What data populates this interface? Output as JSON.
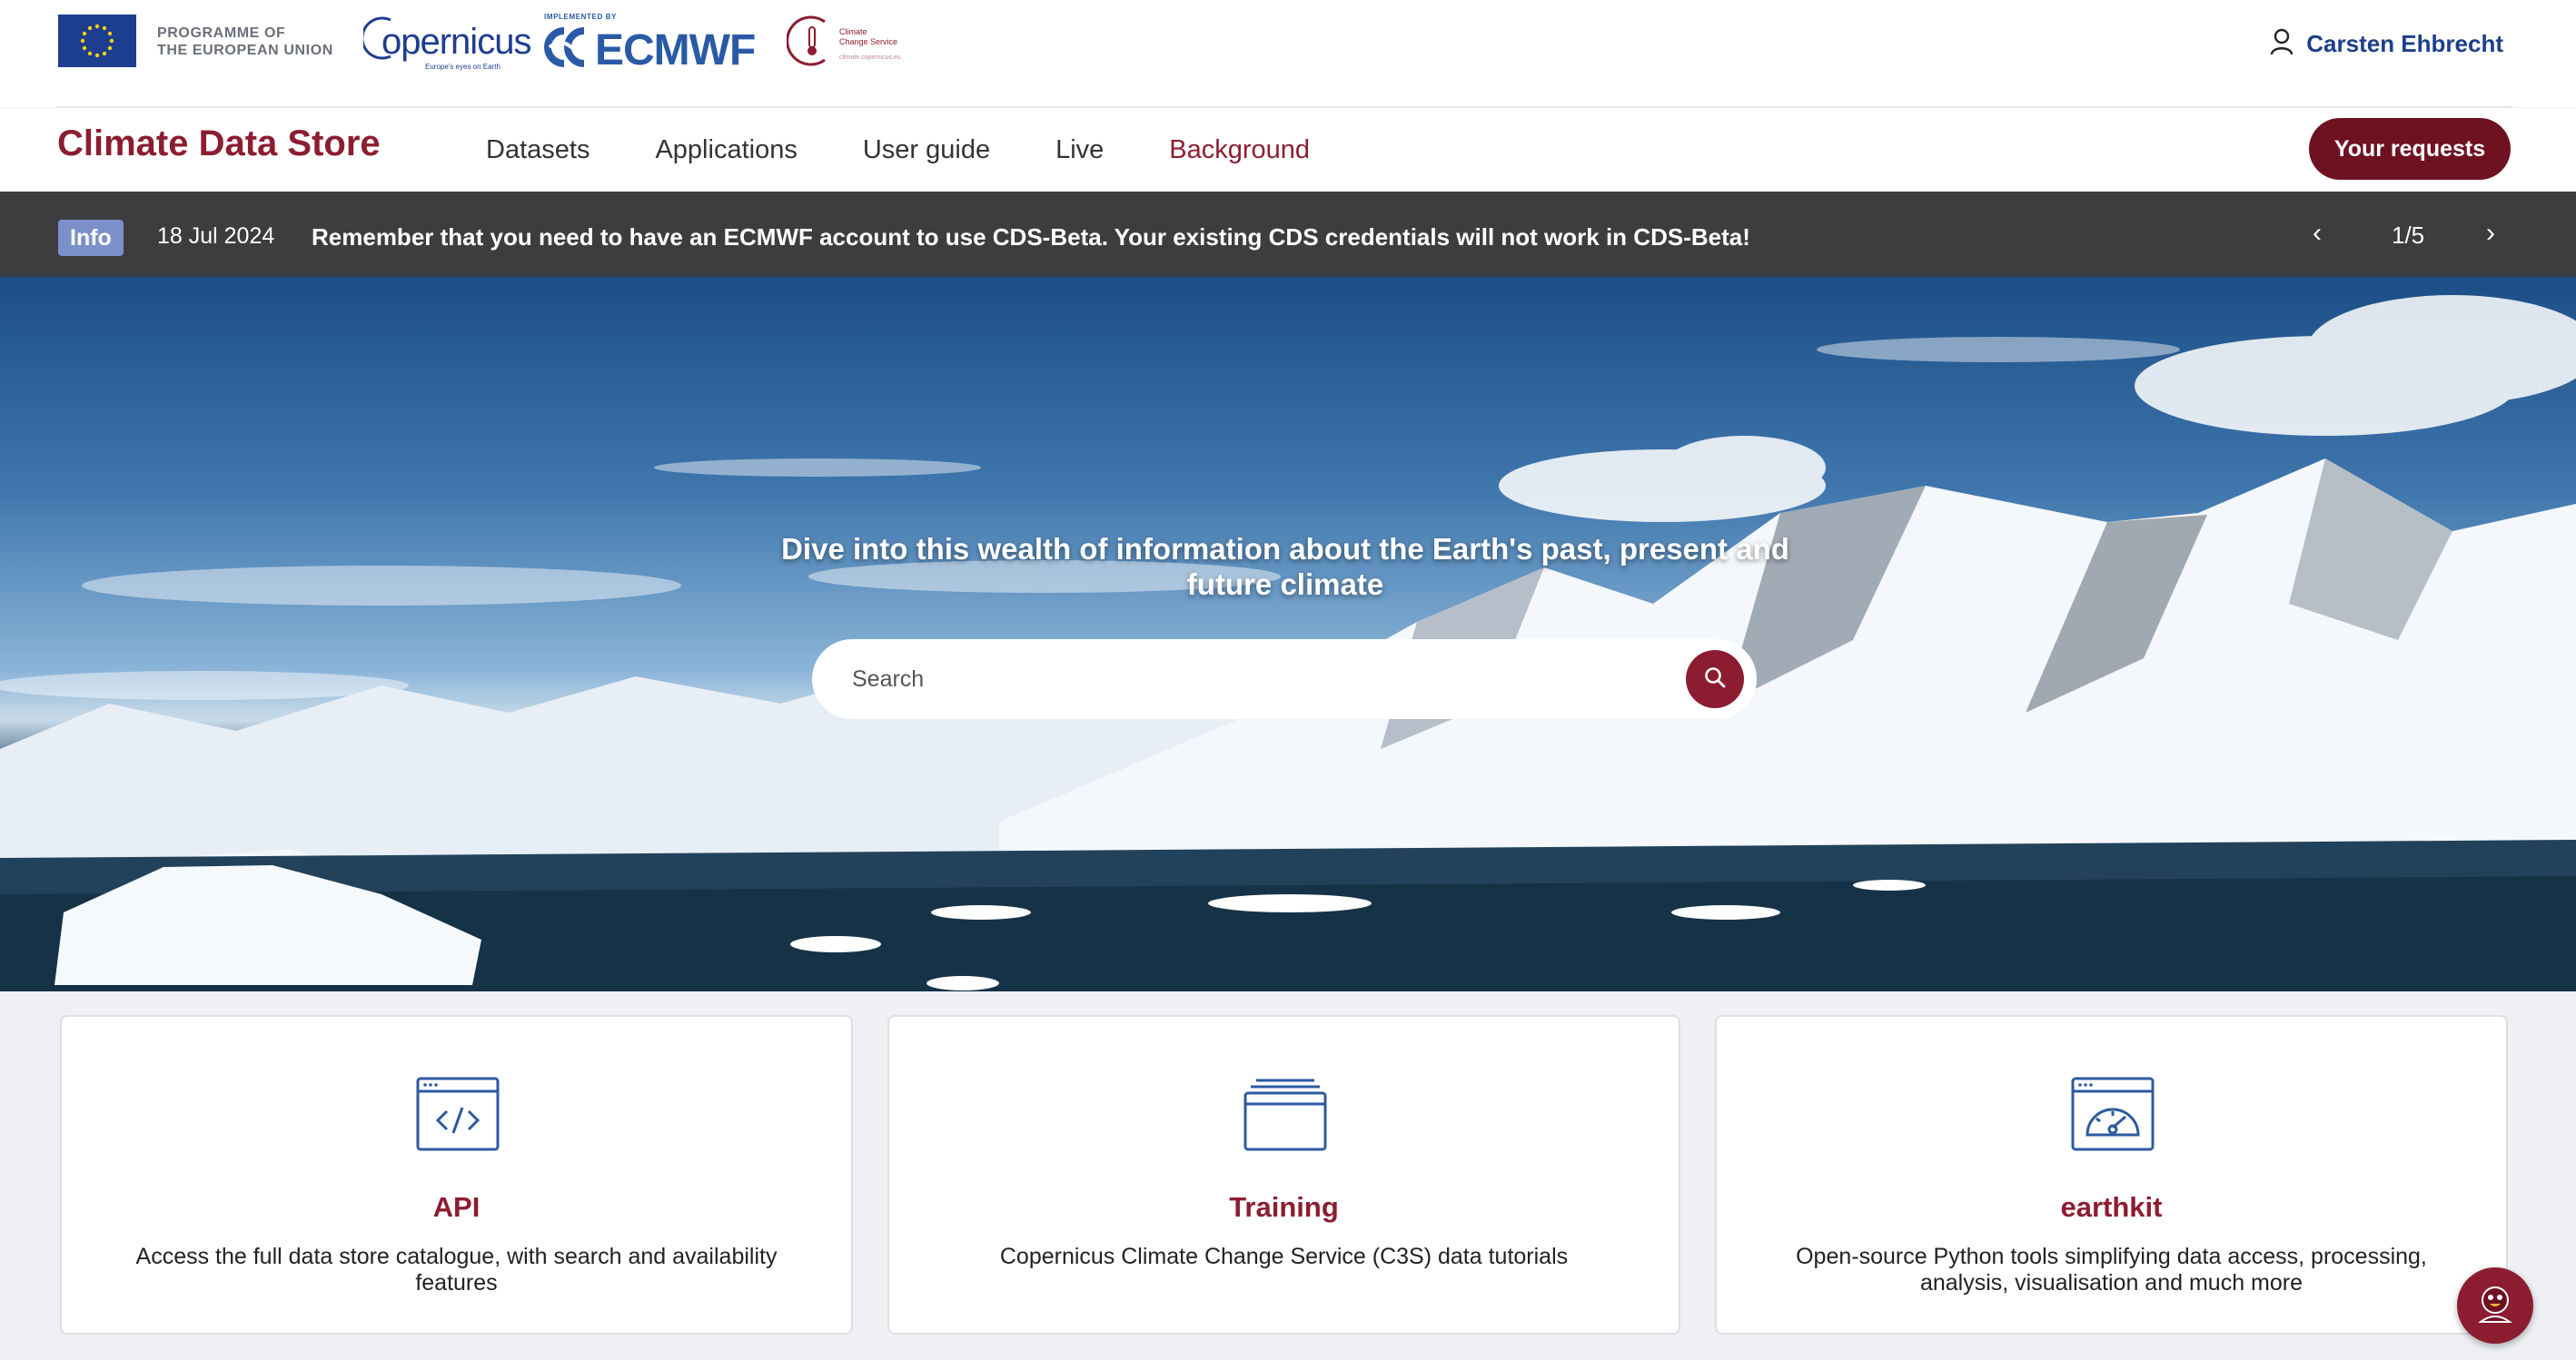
{
  "logos": {
    "eu_line1": "PROGRAMME OF",
    "eu_line2": "THE EUROPEAN UNION",
    "copernicus_word": "opernicus",
    "copernicus_tagline": "Europe's eyes on Earth",
    "ecmwf_implemented": "IMPLEMENTED BY",
    "ecmwf_word": "ECMWF",
    "c3s_line1": "Climate",
    "c3s_line2": "Change Service",
    "c3s_url": "climate.copernicus.eu"
  },
  "user": {
    "name": "Carsten Ehbrecht",
    "icon": "user-icon"
  },
  "nav": {
    "brand": "Climate Data Store",
    "items": [
      {
        "label": "Datasets"
      },
      {
        "label": "Applications"
      },
      {
        "label": "User guide"
      },
      {
        "label": "Live"
      },
      {
        "label": "Background",
        "active": true
      }
    ],
    "requests_button": "Your requests"
  },
  "banner": {
    "badge": "Info",
    "date": "18 Jul 2024",
    "message": "Remember that you need to have an ECMWF account to use CDS-Beta. Your existing CDS credentials will not work in CDS-Beta!",
    "prev_icon": "‹",
    "pager": "1/5",
    "next_icon": "›"
  },
  "hero": {
    "headline": "Dive into this wealth of information about the Earth's past, present and future climate",
    "search_placeholder": "Search",
    "search_icon": "search-icon"
  },
  "cards": [
    {
      "icon": "code-window-icon",
      "title": "API",
      "description": "Access the full data store catalogue, with search and availability features"
    },
    {
      "icon": "stacked-window-icon",
      "title": "Training",
      "description": "Copernicus Climate Change Service (C3S) data tutorials"
    },
    {
      "icon": "gauge-window-icon",
      "title": "earthkit",
      "description": "Open-source Python tools simplifying data access, processing, analysis, visualisation and much more"
    }
  ],
  "colors": {
    "brand": "#8c1d31",
    "button": "#6e1222",
    "banner_bg": "#3c3d3f",
    "badge": "#7b90c9",
    "user_link": "#1c3f8c",
    "card_icon": "#2d5aa0"
  },
  "chat": {
    "icon": "chat-assistant-icon"
  }
}
